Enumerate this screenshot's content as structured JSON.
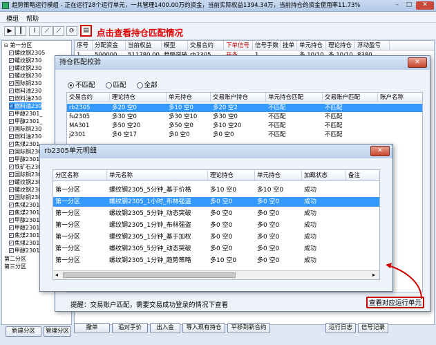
{
  "window": {
    "title": "趋势策略运行模组 - 正在运行28个运行单元，一共管理1400.00万的资金，当前实际权益1394.34万，当前持仓的资金使用率11.73%",
    "min": "–",
    "max": "□",
    "close": "✕"
  },
  "menu": [
    "模组",
    "帮助"
  ],
  "annotation_top": "点击查看持仓匹配情况",
  "tree": {
    "root": "第一分区",
    "items": [
      "螺纹钢2305",
      "螺纹钢230",
      "螺纹钢230",
      "螺纹钢230",
      "国际铜230",
      "燃料油230",
      "燃料油230",
      "燃料油230",
      "甲醇2301_",
      "甲醇2301_",
      "国际铜230",
      "燃料油230",
      "焦煤2301_",
      "国际铜230",
      "甲醇2301_",
      "铁矿石230",
      "国际铜230",
      "螺纹钢230",
      "螺纹钢230",
      "国际铜230",
      "焦煤2301_",
      "焦煤2301_",
      "甲醇2301_",
      "甲醇2301_",
      "焦煤2301_",
      "焦煤2301_",
      "甲醇2301_"
    ],
    "bottom": [
      "第二分区",
      "第三分区"
    ]
  },
  "main_table": {
    "headers": [
      "序号",
      "分配资金",
      "当前权益",
      "模型",
      "交易合约",
      "下单信号",
      "信号手数",
      "挂单",
      "单元持仓",
      "理论持仓",
      "浮动盈亏"
    ],
    "first_row": [
      "1",
      "500000",
      "511780.00",
      "趋势突破",
      "rb2305",
      "开多",
      "1",
      "",
      "多 10/10",
      "多 10/10",
      "8380"
    ]
  },
  "dialog1": {
    "title": "持仓匹配校验",
    "radios": [
      "不匹配",
      "匹配",
      "全部"
    ],
    "headers": [
      "交易合约",
      "理论持仓",
      "单元持仓",
      "交易账户持仓",
      "单元持仓匹配",
      "交易账户匹配",
      "账户名称"
    ],
    "rows": [
      [
        "rb2305",
        "多20 空0",
        "多10 空0",
        "多20 空2",
        "不匹配",
        "不匹配",
        ""
      ],
      [
        "fu2305",
        "多30 空0",
        "多30 空10",
        "多30 空0",
        "不匹配",
        "不匹配",
        ""
      ],
      [
        "MA301",
        "多50 空20",
        "多50 空0",
        "多10 空20",
        "不匹配",
        "不匹配",
        ""
      ],
      [
        "j2301",
        "多0 空17",
        "多0 空0",
        "多0 空0",
        "不匹配",
        "不匹配",
        ""
      ]
    ],
    "hint": "提醒：交易账户匹配，需要交易成功登录的情况下查看",
    "view_button": "查看对应运行单元"
  },
  "dialog2": {
    "title": "rb2305单元明细",
    "headers": [
      "分区名称",
      "单元名称",
      "理论持仓",
      "单元持仓",
      "加载状态",
      "备注"
    ],
    "rows": [
      [
        "第一分区",
        "螺纹钢2305_5分钟_基于价格",
        "多10 空0",
        "多10 空0",
        "成功",
        ""
      ],
      [
        "第一分区",
        "螺纹钢2305_1小时_布林强盗",
        "多0 空0",
        "多0 空0",
        "成功",
        ""
      ],
      [
        "第一分区",
        "螺纹钢2305_5分钟_动态突破",
        "多0 空0",
        "多0 空0",
        "成功",
        ""
      ],
      [
        "第一分区",
        "螺纹钢2305_1分钟_布林强盗",
        "多0 空0",
        "多0 空0",
        "成功",
        ""
      ],
      [
        "第一分区",
        "螺纹钢2305_1分钟_基于加权",
        "多0 空0",
        "多0 空0",
        "成功",
        ""
      ],
      [
        "第一分区",
        "螺纹钢2305_5分钟_动态突破",
        "多0 空0",
        "多0 空0",
        "成功",
        ""
      ],
      [
        "第一分区",
        "螺纹钢2305_1分钟_趋势策略",
        "多10 空0",
        "多0 空0",
        "成功",
        ""
      ]
    ]
  },
  "bottom_buttons": [
    "新建分区",
    "管理分区",
    "撤单",
    "追对手价",
    "出入金",
    "导入现有持仓",
    "平移到新合约",
    "运行日志",
    "信号记录"
  ],
  "colors": {
    "annotation": "#e00000",
    "select": "#3399ff",
    "accent": "#c00000"
  }
}
